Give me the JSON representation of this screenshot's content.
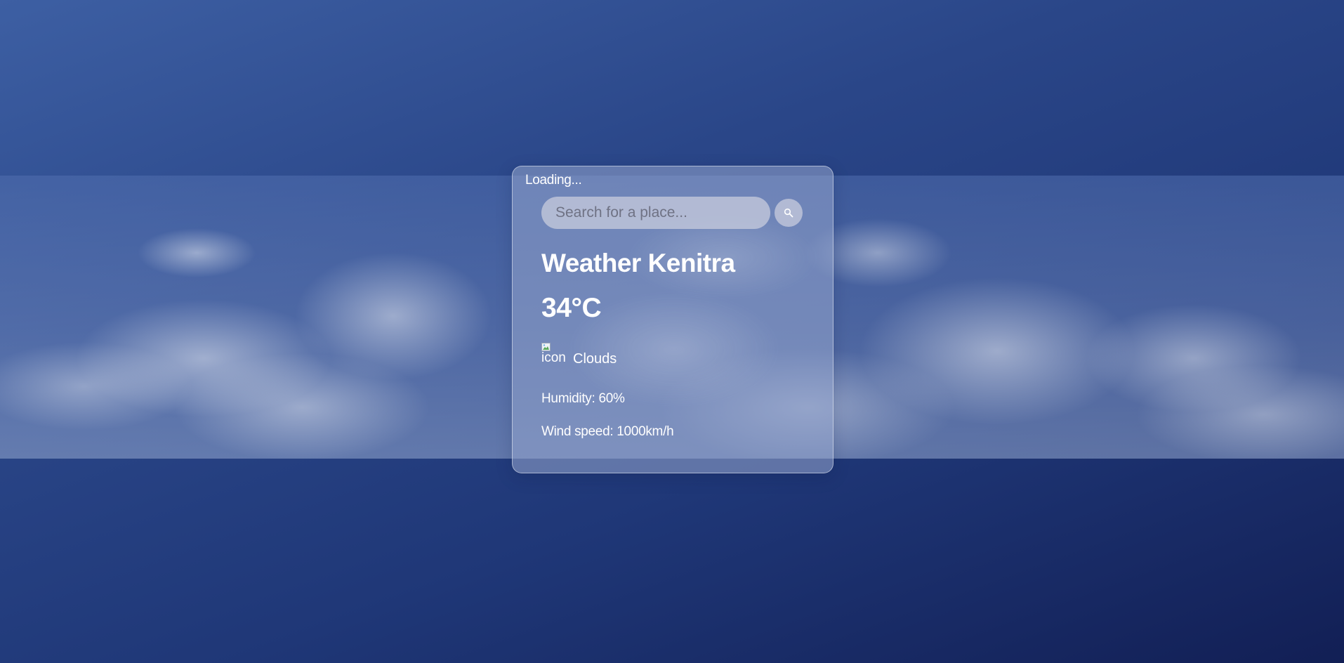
{
  "status": {
    "loading_text": "Loading..."
  },
  "search": {
    "placeholder": "Search for a place...",
    "value": "",
    "button_icon": "search-icon"
  },
  "weather": {
    "title": "Weather Kenitra",
    "temperature": "34°C",
    "icon_alt": "icon",
    "description": "Clouds",
    "humidity": "Humidity: 60%",
    "wind_speed": "Wind speed: 1000km/h"
  },
  "colors": {
    "background_top": "#3d5fa3",
    "background_bottom": "#121f55",
    "text": "#ffffff"
  }
}
